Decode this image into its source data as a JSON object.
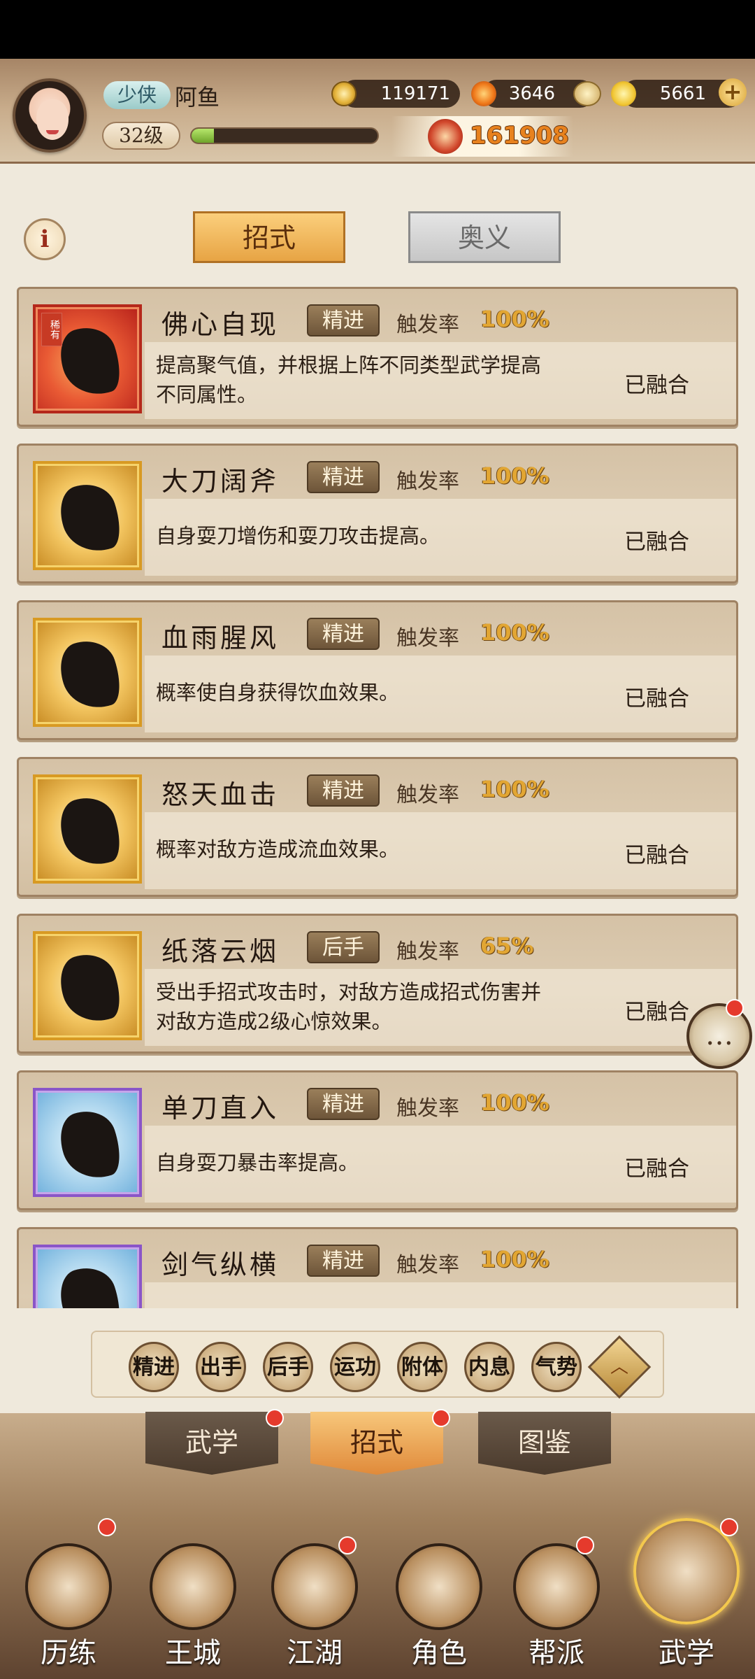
{
  "header": {
    "rank_badge": "少侠",
    "player_name": "阿鱼",
    "level": "32级",
    "exp_progress": 0.12,
    "coins": "119171",
    "fire_points": "3646",
    "ingots": "5661",
    "plus_label": "+",
    "combat_power": "161908"
  },
  "top_tabs": [
    {
      "label": "招式",
      "active": true
    },
    {
      "label": "奥义",
      "active": false
    }
  ],
  "info_label": "i",
  "rate_label": "触发率",
  "rare_tag": "稀有",
  "skills": [
    {
      "name": "佛心自现",
      "type": "精进",
      "rate": "100%",
      "desc": "提高聚气值，并根据上阵不同类型武学提高不同属性。",
      "status": "已融合",
      "frame": "red"
    },
    {
      "name": "大刀阔斧",
      "type": "精进",
      "rate": "100%",
      "desc": "自身耍刀增伤和耍刀攻击提高。",
      "status": "已融合",
      "frame": "gold"
    },
    {
      "name": "血雨腥风",
      "type": "精进",
      "rate": "100%",
      "desc": "概率使自身获得饮血效果。",
      "status": "已融合",
      "frame": "gold"
    },
    {
      "name": "怒天血击",
      "type": "精进",
      "rate": "100%",
      "desc": "概率对敌方造成流血效果。",
      "status": "已融合",
      "frame": "gold"
    },
    {
      "name": "纸落云烟",
      "type": "后手",
      "rate": "65%",
      "desc": "受出手招式攻击时，对敌方造成招式伤害并对敌方造成2级心惊效果。",
      "status": "已融合",
      "frame": "gold"
    },
    {
      "name": "单刀直入",
      "type": "精进",
      "rate": "100%",
      "desc": "自身耍刀暴击率提高。",
      "status": "已融合",
      "frame": "purple"
    },
    {
      "name": "剑气纵横",
      "type": "精进",
      "rate": "100%",
      "desc": "",
      "status": "",
      "frame": "purple"
    }
  ],
  "chat_icon": "chat-bubble-icon",
  "filters": [
    {
      "label": "精进"
    },
    {
      "label": "出手"
    },
    {
      "label": "后手"
    },
    {
      "label": "运功"
    },
    {
      "label": "附体"
    },
    {
      "label": "内息"
    },
    {
      "label": "气势"
    }
  ],
  "filter_collapse_label": "︿",
  "sub_tabs": [
    {
      "label": "武学",
      "active": false
    },
    {
      "label": "招式",
      "active": true
    },
    {
      "label": "图鉴",
      "active": false
    }
  ],
  "bottom_nav": [
    {
      "label": "历练",
      "active": false
    },
    {
      "label": "王城",
      "active": false
    },
    {
      "label": "江湖",
      "active": false
    },
    {
      "label": "角色",
      "active": false
    },
    {
      "label": "帮派",
      "active": false
    },
    {
      "label": "武学",
      "active": true
    }
  ],
  "colors": {
    "accent_orange": "#e7a444",
    "rate_gold": "#e2a633",
    "red_dot": "#e53a2c"
  }
}
